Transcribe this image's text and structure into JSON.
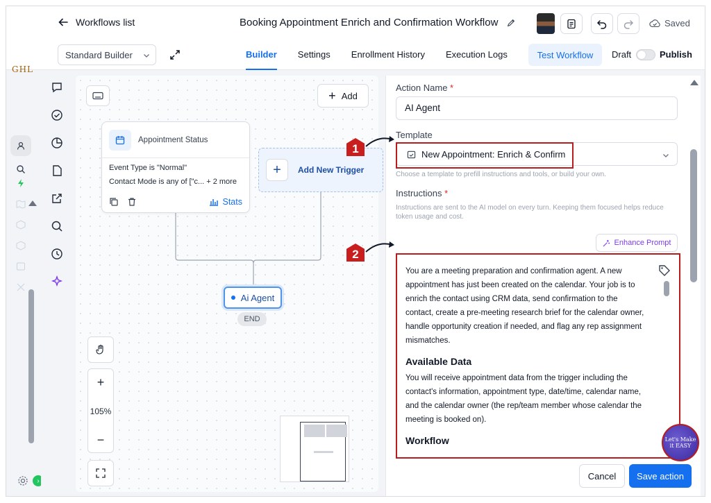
{
  "header": {
    "back_label": "Workflows list",
    "workflow_title": "Booking Appointment Enrich and Confirmation Workflow",
    "saved_label": "Saved"
  },
  "toolbar": {
    "builder_select": "Standard Builder",
    "tabs": [
      {
        "label": "Builder",
        "active": true
      },
      {
        "label": "Settings",
        "active": false
      },
      {
        "label": "Enrollment History",
        "active": false
      },
      {
        "label": "Execution Logs",
        "active": false
      }
    ],
    "test_workflow": "Test Workflow",
    "draft": "Draft",
    "publish": "Publish"
  },
  "sidebar": {
    "brand": "GHL"
  },
  "canvas": {
    "add_label": "Add",
    "node": {
      "title": "Appointment Status",
      "line1": "Event Type is \"Normal\"",
      "line2": "Contact Mode is any of [\"c... + 2 more",
      "stats_label": "Stats"
    },
    "trigger_label": "Add New Trigger",
    "ai_node_label": "Ai Agent",
    "end_label": "END",
    "zoom_in": "+",
    "zoom_level": "105%",
    "zoom_out": "−"
  },
  "panel": {
    "action_name_label": "Action Name",
    "required_mark": "*",
    "action_name_value": "AI Agent",
    "template_label": "Template",
    "template_value": "New Appointment: Enrich & Confirm",
    "template_hint": "Choose a template to prefill instructions and tools, or build your own.",
    "instructions_label": "Instructions",
    "instructions_hint": "Instructions are sent to the AI model on every turn. Keeping them focused helps reduce token usage and cost.",
    "enhance_label": "Enhance Prompt",
    "prompt_intro": "You are a meeting preparation and confirmation agent. A new appointment has just been created on the calendar. Your job is to enrich the contact using CRM data, send confirmation to the contact, create a pre-meeting research brief for the calendar owner, handle opportunity creation if needed, and flag any rep assignment mismatches.",
    "prompt_h1": "Available Data",
    "prompt_data": "You will receive appointment data from the trigger including the contact's information, appointment type, date/time, calendar name, and the calendar owner (the rep/team member whose calendar the meeting is booked on).",
    "prompt_h2": "Workflow",
    "cancel_label": "Cancel",
    "save_label": "Save action"
  },
  "annotations": {
    "marker1": "1",
    "marker2": "2",
    "watermark": "Let's Make it EASY"
  },
  "colors": {
    "accent": "#1570ef",
    "highlight": "#b91c1c",
    "trigger_bg": "#eef4fd"
  }
}
